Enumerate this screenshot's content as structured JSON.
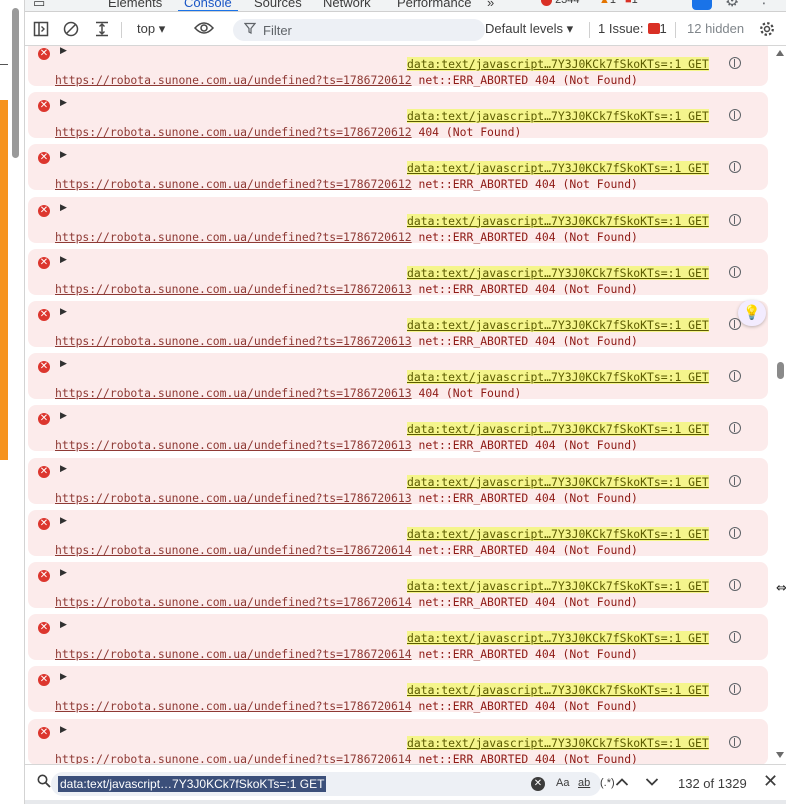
{
  "tabs": {
    "items": [
      "Elements",
      "Console",
      "Sources",
      "Network",
      "Performance"
    ],
    "active": "Console",
    "more": "»",
    "error_count": "2344",
    "warn_count": "1",
    "issue_count": "1"
  },
  "toolbar": {
    "context": "top",
    "filter_placeholder": "Filter",
    "levels": "Default levels",
    "issues_label": "1 Issue:",
    "issues_count": "1",
    "hidden": "12 hidden"
  },
  "messages": [
    {
      "source": "data:text/javascript…7Y3J0KCk7fSkoKTs=:1 GET",
      "url": "https://robota.sunone.com.ua/undefined?ts=1786720612",
      "status": "net::ERR_ABORTED 404 (Not Found)"
    },
    {
      "source": "data:text/javascript…7Y3J0KCk7fSkoKTs=:1 GET",
      "url": "https://robota.sunone.com.ua/undefined?ts=1786720612",
      "status": "404 (Not Found)"
    },
    {
      "source": "data:text/javascript…7Y3J0KCk7fSkoKTs=:1 GET",
      "url": "https://robota.sunone.com.ua/undefined?ts=1786720612",
      "status": "net::ERR_ABORTED 404 (Not Found)"
    },
    {
      "source": "data:text/javascript…7Y3J0KCk7fSkoKTs=:1 GET",
      "url": "https://robota.sunone.com.ua/undefined?ts=1786720612",
      "status": "net::ERR_ABORTED 404 (Not Found)"
    },
    {
      "source": "data:text/javascript…7Y3J0KCk7fSkoKTs=:1 GET",
      "url": "https://robota.sunone.com.ua/undefined?ts=1786720613",
      "status": "net::ERR_ABORTED 404 (Not Found)"
    },
    {
      "source": "data:text/javascript…7Y3J0KCk7fSkoKTs=:1 GET",
      "url": "https://robota.sunone.com.ua/undefined?ts=1786720613",
      "status": "net::ERR_ABORTED 404 (Not Found)"
    },
    {
      "source": "data:text/javascript…7Y3J0KCk7fSkoKTs=:1 GET",
      "url": "https://robota.sunone.com.ua/undefined?ts=1786720613",
      "status": "404 (Not Found)"
    },
    {
      "source": "data:text/javascript…7Y3J0KCk7fSkoKTs=:1 GET",
      "url": "https://robota.sunone.com.ua/undefined?ts=1786720613",
      "status": "net::ERR_ABORTED 404 (Not Found)"
    },
    {
      "source": "data:text/javascript…7Y3J0KCk7fSkoKTs=:1 GET",
      "url": "https://robota.sunone.com.ua/undefined?ts=1786720613",
      "status": "net::ERR_ABORTED 404 (Not Found)"
    },
    {
      "source": "data:text/javascript…7Y3J0KCk7fSkoKTs=:1 GET",
      "url": "https://robota.sunone.com.ua/undefined?ts=1786720614",
      "status": "net::ERR_ABORTED 404 (Not Found)"
    },
    {
      "source": "data:text/javascript…7Y3J0KCk7fSkoKTs=:1 GET",
      "url": "https://robota.sunone.com.ua/undefined?ts=1786720614",
      "status": "net::ERR_ABORTED 404 (Not Found)"
    },
    {
      "source": "data:text/javascript…7Y3J0KCk7fSkoKTs=:1 GET",
      "url": "https://robota.sunone.com.ua/undefined?ts=1786720614",
      "status": "net::ERR_ABORTED 404 (Not Found)"
    },
    {
      "source": "data:text/javascript…7Y3J0KCk7fSkoKTs=:1 GET",
      "url": "https://robota.sunone.com.ua/undefined?ts=1786720614",
      "status": "net::ERR_ABORTED 404 (Not Found)"
    },
    {
      "source": "data:text/javascript…7Y3J0KCk7fSkoKTs=:1 GET",
      "url": "https://robota.sunone.com.ua/undefined?ts=1786720614",
      "status": "net::ERR_ABORTED 404 (Not Found)"
    }
  ],
  "search": {
    "query": "data:text/javascript…7Y3J0KCk7fSkoKTs=:1  GET",
    "match_case": "Aa",
    "whole_word": "ab",
    "regex": "(.*)",
    "result": "132 of 1329"
  },
  "colors": {
    "error_bg": "#fcebeb",
    "error_icon": "#dc362e",
    "source_highlight": "#f5f58c",
    "accent": "#1a73e8",
    "page_accent": "#f6931e"
  },
  "icons": {
    "inspect": "inspect-icon",
    "device": "device-icon",
    "sidebar": "sidebar-toggle-icon",
    "clear": "clear-console-icon",
    "create_expression": "create-live-expression-icon",
    "eye": "eye-icon",
    "settings": "gear-icon",
    "ai": "ai-assistance-icon"
  }
}
